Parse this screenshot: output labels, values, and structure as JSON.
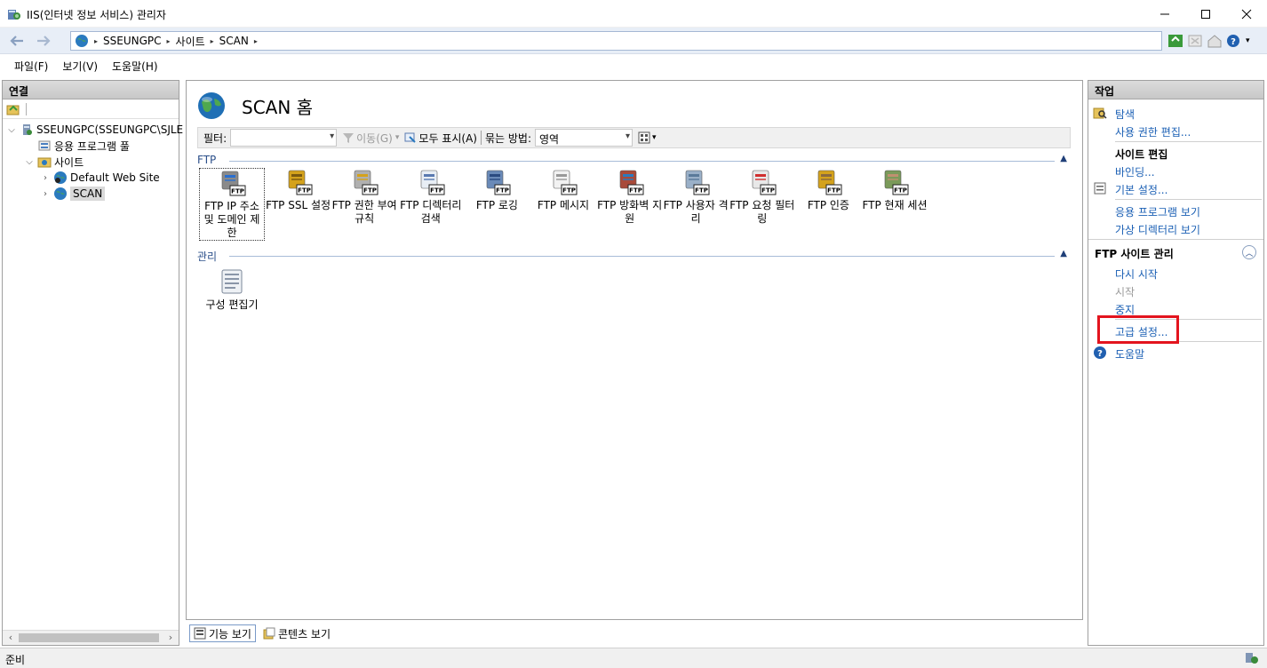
{
  "window": {
    "title": "IIS(인터넷 정보 서비스) 관리자",
    "app_icon": "iis-manager-icon",
    "controls": [
      "minimize-icon",
      "maximize-icon",
      "close-icon"
    ]
  },
  "address_bar": {
    "crumbs": [
      "SSEUNGPC",
      "사이트",
      "SCAN"
    ],
    "separator": "▸"
  },
  "menu": {
    "items": [
      "파일(F)",
      "보기(V)",
      "도움말(H)"
    ]
  },
  "connections": {
    "header": "연결",
    "tree": [
      {
        "label": "SSEUNGPC(SSEUNGPC\\SJLE",
        "icon": "server-icon",
        "expander": "⌵"
      },
      {
        "label": "응용 프로그램 풀",
        "icon": "app-pool-icon",
        "expander": ""
      },
      {
        "label": "사이트",
        "icon": "sites-folder-icon",
        "expander": "⌵"
      },
      {
        "label": "Default Web Site",
        "icon": "website-icon",
        "expander": "›"
      },
      {
        "label": "SCAN",
        "icon": "globe-icon",
        "expander": "›"
      }
    ]
  },
  "center": {
    "title": "SCAN 홈",
    "filter": {
      "label": "필터:",
      "go_label": "이동(G)",
      "show_all_label": "모두 표시(A)",
      "group_by_label": "묶는 방법:",
      "group_by_value": "영역"
    },
    "groups": [
      {
        "name": "FTP",
        "features": [
          {
            "label": "FTP IP 주소 및 도메인 제한",
            "icon": "ftp-ip-restrictions-icon"
          },
          {
            "label": "FTP SSL 설정",
            "icon": "ftp-ssl-lock-icon"
          },
          {
            "label": "FTP 권한 부여 규칙",
            "icon": "ftp-authorization-key-icon"
          },
          {
            "label": "FTP 디렉터리 검색",
            "icon": "ftp-directory-browsing-icon"
          },
          {
            "label": "FTP 로깅",
            "icon": "ftp-logging-icon"
          },
          {
            "label": "FTP 메시지",
            "icon": "ftp-messages-icon"
          },
          {
            "label": "FTP 방화벽 지원",
            "icon": "ftp-firewall-icon"
          },
          {
            "label": "FTP 사용자 격리",
            "icon": "ftp-user-isolation-icon"
          },
          {
            "label": "FTP 요청 필터링",
            "icon": "ftp-request-filtering-icon"
          },
          {
            "label": "FTP 인증",
            "icon": "ftp-authentication-icon"
          },
          {
            "label": "FTP 현재 세션",
            "icon": "ftp-current-sessions-icon"
          }
        ]
      },
      {
        "name": "관리",
        "features": [
          {
            "label": "구성 편집기",
            "icon": "configuration-editor-icon"
          }
        ]
      }
    ],
    "ftp_badge": "FTP"
  },
  "bottom_tabs": {
    "features_view": "기능 보기",
    "content_view": "콘텐츠 보기"
  },
  "actions": {
    "header": "작업",
    "explore": "탐색",
    "edit_permissions": "사용 권한 편집...",
    "edit_site_header": "사이트 편집",
    "bindings": "바인딩...",
    "basic_settings": "기본 설정...",
    "view_applications": "응용 프로그램 보기",
    "view_virtual_directories": "가상 디렉터리 보기",
    "ftp_manage_header": "FTP 사이트 관리",
    "restart": "다시 시작",
    "start": "시작",
    "stop": "중지",
    "advanced_settings": "고급 설정...",
    "help": "도움말"
  },
  "status": {
    "text": "준비"
  },
  "colors": {
    "link": "#1a5fb4",
    "highlight": "#e3141e",
    "group_header": "#2b4f8a"
  }
}
